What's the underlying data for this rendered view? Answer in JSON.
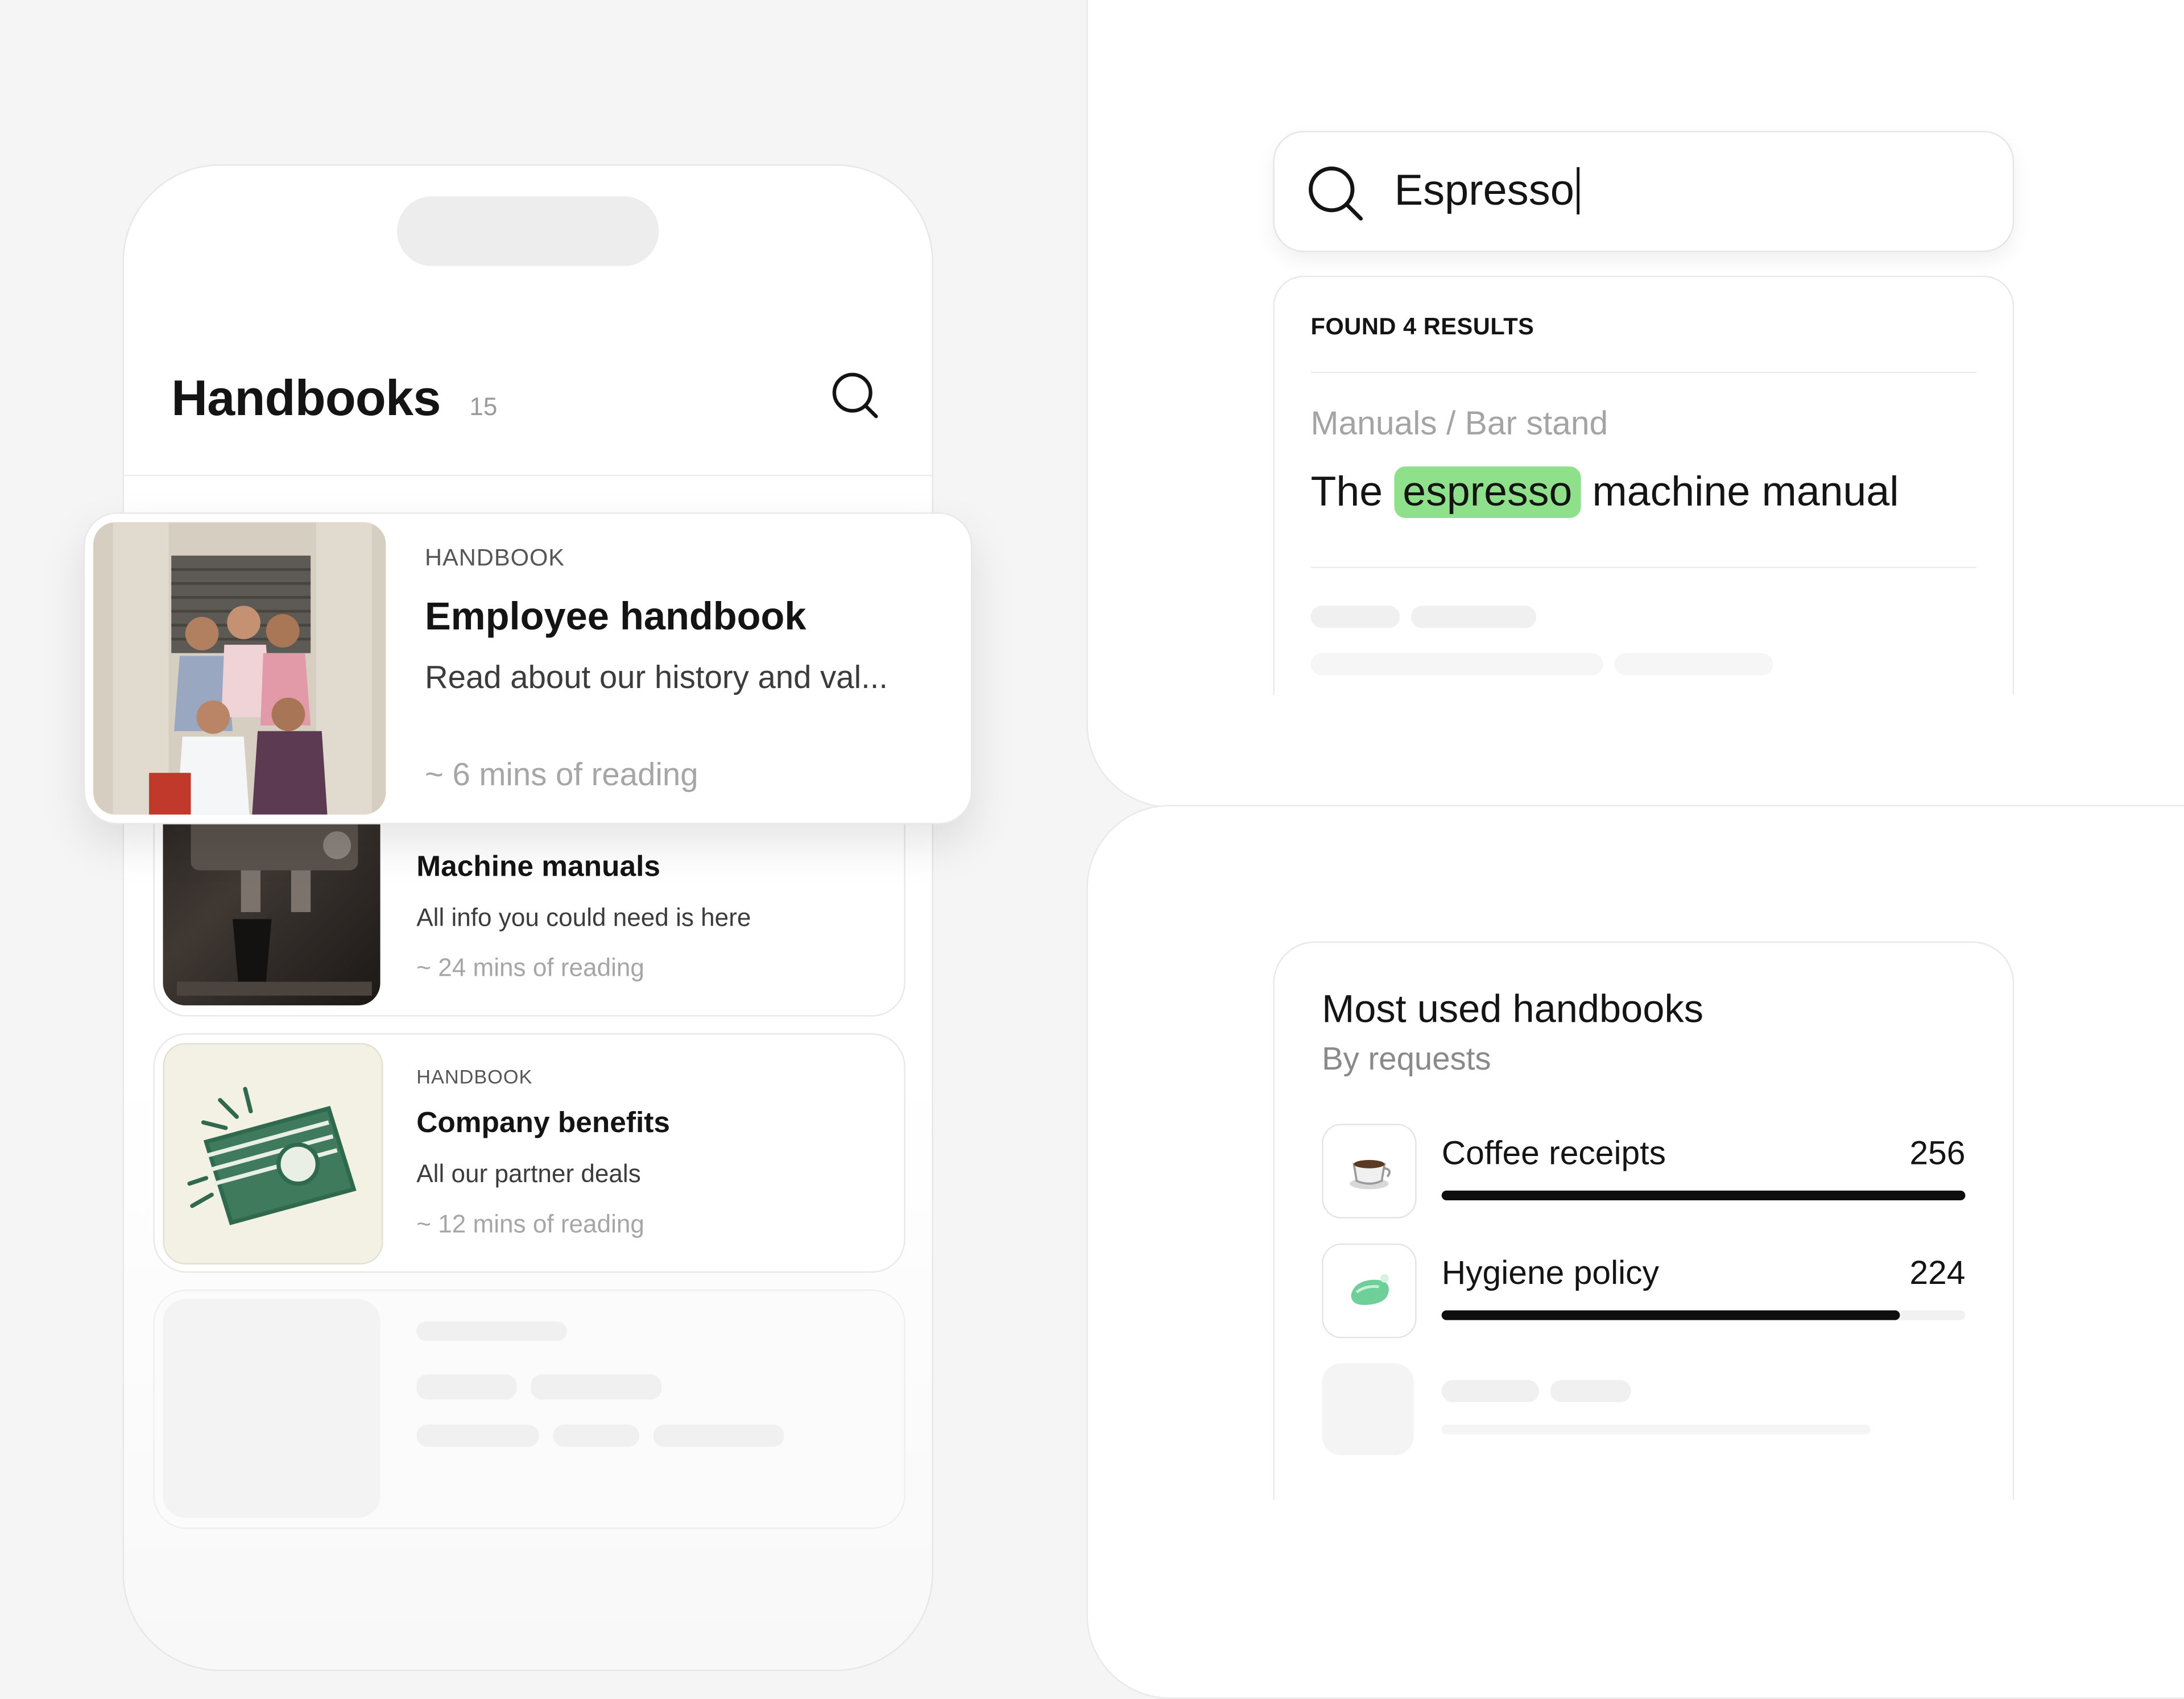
{
  "phone": {
    "title": "Handbooks",
    "count": "15",
    "cards": [
      {
        "kicker": "HANDBOOK",
        "title": "Employee handbook",
        "description": "Read about our history and val...",
        "reading": "~ 6 mins of reading"
      },
      {
        "title": "Machine manuals",
        "description": "All info you could need is here",
        "reading": "~ 24 mins of reading"
      },
      {
        "kicker": "HANDBOOK",
        "title": "Company benefits",
        "description": "All our partner deals",
        "reading": "~ 12 mins of reading"
      }
    ]
  },
  "search": {
    "value": "Espresso",
    "found": "FOUND 4 RESULTS",
    "result": {
      "path": "Manuals / Bar stand",
      "title_before": "The",
      "title_highlight": "espresso",
      "title_after": "machine manual"
    }
  },
  "most_used": {
    "title": "Most used handbooks",
    "subtitle": "By requests",
    "items": [
      {
        "name": "Coffee receipts",
        "value": "256",
        "fraction": 1.0,
        "icon": "coffee-cup-icon"
      },
      {
        "name": "Hygiene policy",
        "value": "224",
        "fraction": 0.875,
        "icon": "soap-icon"
      }
    ]
  },
  "colors": {
    "highlight": "#8fe08a",
    "bar": "#0e0e0e",
    "accent_green": "#2f6a4f"
  }
}
